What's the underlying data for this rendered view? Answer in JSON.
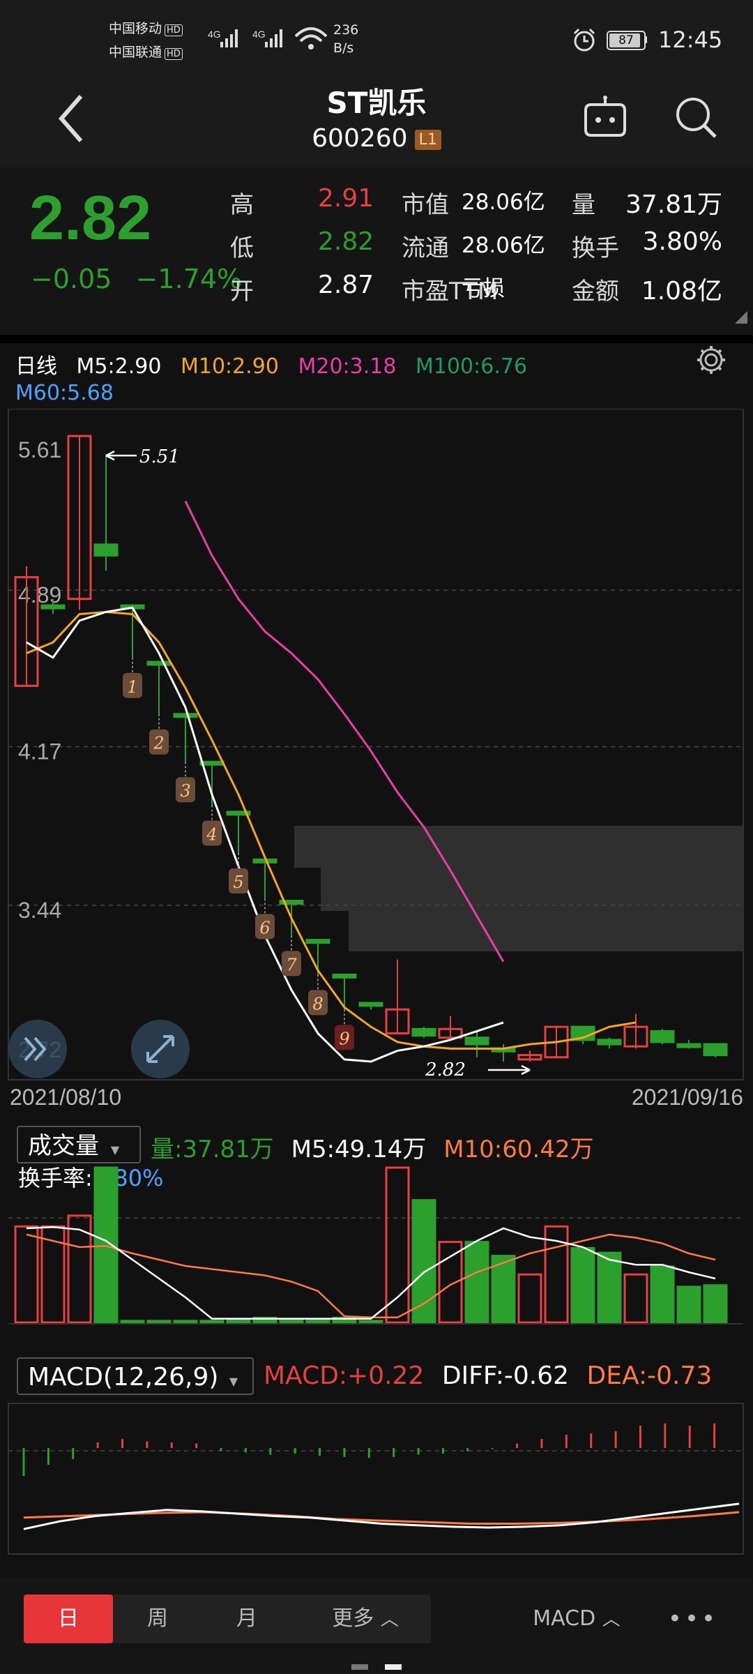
{
  "status_bar": {
    "carrier1": "中国移动",
    "carrier2": "中国联通",
    "hd": "HD",
    "net": "4G",
    "speed_value": "236",
    "speed_unit": "B/s",
    "battery": "87",
    "time": "12:45"
  },
  "header": {
    "title": "ST凯乐",
    "code": "600260",
    "badge": "L1"
  },
  "quote": {
    "price": "2.82",
    "change": "−0.05",
    "change_pct": "−1.74%",
    "rows": [
      {
        "l1": "高",
        "v1": "2.91",
        "c1": "#e84040",
        "l2": "市值",
        "v2": "28.06亿",
        "l3": "量",
        "v3": "37.81万"
      },
      {
        "l1": "低",
        "v1": "2.82",
        "c1": "#2ca02c",
        "l2": "流通",
        "v2": "28.06亿",
        "l3": "换手",
        "v3": "3.80%"
      },
      {
        "l1": "开",
        "v1": "2.87",
        "c1": "#ffffff",
        "l2": "市盈TTM",
        "v2": "亏损",
        "l3": "金额",
        "v3": "1.08亿"
      }
    ]
  },
  "kline": {
    "period_label": "日线",
    "m5": "M5:2.90",
    "m10": "M10:2.90",
    "m20": "M20:3.18",
    "m100": "M100:6.76",
    "m60": "M60:5.68",
    "price_ticks": [
      "5.61",
      "4.89",
      "4.17",
      "3.44",
      "2.72"
    ],
    "high_marker": "5.51",
    "low_marker": "2.82",
    "date_start": "2021/08/10",
    "date_end": "2021/09/16",
    "annotations": [
      "1",
      "2",
      "3",
      "4",
      "5",
      "6",
      "7",
      "8",
      "9"
    ]
  },
  "volume": {
    "label": "成交量",
    "vol": "量:37.81万",
    "m5": "M5:49.14万",
    "m10": "M10:60.42万",
    "turnover_label": "换手率:",
    "turnover": "3.80%"
  },
  "macd": {
    "label": "MACD(12,26,9)",
    "macd": "MACD:+0.22",
    "diff": "DIFF:-0.62",
    "dea": "DEA:-0.73"
  },
  "tabs": [
    "日",
    "周",
    "月",
    "更多"
  ],
  "indicator_tab": "MACD",
  "colors": {
    "up": "#e84040",
    "down": "#2ca02c",
    "m5": "#ffffff",
    "m10": "#f5a623",
    "m20": "#e83ea8",
    "m100": "#1f9a6a",
    "m60": "#4aa3ff"
  },
  "chart_data": {
    "type": "candlestick",
    "x_range": [
      "2021/08/10",
      "2021/09/16"
    ],
    "y_range": [
      2.72,
      5.61
    ],
    "y_ticks": [
      5.61,
      4.89,
      4.17,
      3.44,
      2.72
    ],
    "candles": [
      {
        "o": 4.45,
        "c": 4.95,
        "h": 5.0,
        "l": 4.45
      },
      {
        "o": 4.82,
        "c": 4.82,
        "h": 4.85,
        "l": 4.78
      },
      {
        "o": 4.85,
        "c": 5.6,
        "h": 5.6,
        "l": 4.8
      },
      {
        "o": 5.1,
        "c": 5.05,
        "h": 5.51,
        "l": 4.98
      },
      {
        "o": 4.82,
        "c": 4.82,
        "h": 4.82,
        "l": 4.58
      },
      {
        "o": 4.56,
        "c": 4.56,
        "h": 4.56,
        "l": 4.32
      },
      {
        "o": 4.32,
        "c": 4.32,
        "h": 4.32,
        "l": 4.1
      },
      {
        "o": 4.1,
        "c": 4.1,
        "h": 4.1,
        "l": 3.9
      },
      {
        "o": 3.87,
        "c": 3.87,
        "h": 3.87,
        "l": 3.68
      },
      {
        "o": 3.65,
        "c": 3.65,
        "h": 3.65,
        "l": 3.47
      },
      {
        "o": 3.46,
        "c": 3.46,
        "h": 3.46,
        "l": 3.3
      },
      {
        "o": 3.28,
        "c": 3.28,
        "h": 3.28,
        "l": 3.12
      },
      {
        "o": 3.12,
        "c": 3.12,
        "h": 3.12,
        "l": 2.96
      },
      {
        "o": 2.99,
        "c": 2.99,
        "h": 2.99,
        "l": 2.96
      },
      {
        "o": 2.85,
        "c": 2.96,
        "h": 3.19,
        "l": 2.85
      },
      {
        "o": 2.87,
        "c": 2.84,
        "h": 2.88,
        "l": 2.83
      },
      {
        "o": 2.83,
        "c": 2.87,
        "h": 2.93,
        "l": 2.82
      },
      {
        "o": 2.83,
        "c": 2.8,
        "h": 2.86,
        "l": 2.74
      },
      {
        "o": 2.78,
        "c": 2.78,
        "h": 2.8,
        "l": 2.72
      },
      {
        "o": 2.73,
        "c": 2.75,
        "h": 2.77,
        "l": 2.72
      },
      {
        "o": 2.74,
        "c": 2.88,
        "h": 2.88,
        "l": 2.74
      },
      {
        "o": 2.88,
        "c": 2.82,
        "h": 2.88,
        "l": 2.8
      },
      {
        "o": 2.82,
        "c": 2.8,
        "h": 2.83,
        "l": 2.78
      },
      {
        "o": 2.79,
        "c": 2.88,
        "h": 2.94,
        "l": 2.78
      },
      {
        "o": 2.86,
        "c": 2.81,
        "h": 2.87,
        "l": 2.8
      },
      {
        "o": 2.8,
        "c": 2.79,
        "h": 2.82,
        "l": 2.78
      },
      {
        "o": 2.8,
        "c": 2.75,
        "h": 2.8,
        "l": 2.74
      }
    ],
    "ma5": [
      4.65,
      4.58,
      4.75,
      4.79,
      4.81,
      4.6,
      4.35,
      3.95,
      3.62,
      3.3,
      3.05,
      2.85,
      2.73,
      2.72,
      2.77,
      2.79,
      2.82,
      2.86,
      2.9
    ],
    "ma10": [
      4.6,
      4.65,
      4.78,
      4.79,
      4.78,
      4.65,
      4.44,
      4.2,
      3.95,
      3.66,
      3.38,
      3.14,
      2.97,
      2.88,
      2.81,
      2.79,
      2.78,
      2.78,
      2.78,
      2.8,
      2.81,
      2.83,
      2.88,
      2.9
    ],
    "ma20": [
      5.3,
      5.05,
      4.85,
      4.7,
      4.6,
      4.48,
      4.32,
      4.15,
      3.96,
      3.8,
      3.6,
      3.39,
      3.18
    ],
    "volume": [
      62,
      62,
      69,
      100,
      1,
      1,
      1,
      1,
      2,
      3,
      2,
      2,
      3,
      1,
      100,
      79,
      52,
      52,
      43,
      31,
      62,
      48,
      45,
      31,
      36,
      23,
      24
    ],
    "macd_hist": [
      -0.25,
      -0.15,
      -0.1,
      0.05,
      0.08,
      0.06,
      0.05,
      0.04,
      -0.03,
      -0.04,
      -0.06,
      -0.05,
      -0.07,
      -0.08,
      -0.09,
      -0.08,
      -0.06,
      -0.05,
      -0.03,
      -0.01,
      0.04,
      0.08,
      0.12,
      0.13,
      0.15,
      0.2,
      0.22,
      0.2,
      0.22
    ],
    "diff": [
      -0.95,
      -0.85,
      -0.78,
      -0.74,
      -0.7,
      -0.72,
      -0.75,
      -0.78,
      -0.8,
      -0.84,
      -0.88,
      -0.9,
      -0.92,
      -0.93,
      -0.92,
      -0.9,
      -0.86,
      -0.8,
      -0.74,
      -0.68,
      -0.62
    ],
    "dea": [
      -0.8,
      -0.78,
      -0.76,
      -0.74,
      -0.73,
      -0.75,
      -0.78,
      -0.82,
      -0.84,
      -0.86,
      -0.88,
      -0.88,
      -0.87,
      -0.85,
      -0.82,
      -0.78,
      -0.73
    ]
  }
}
